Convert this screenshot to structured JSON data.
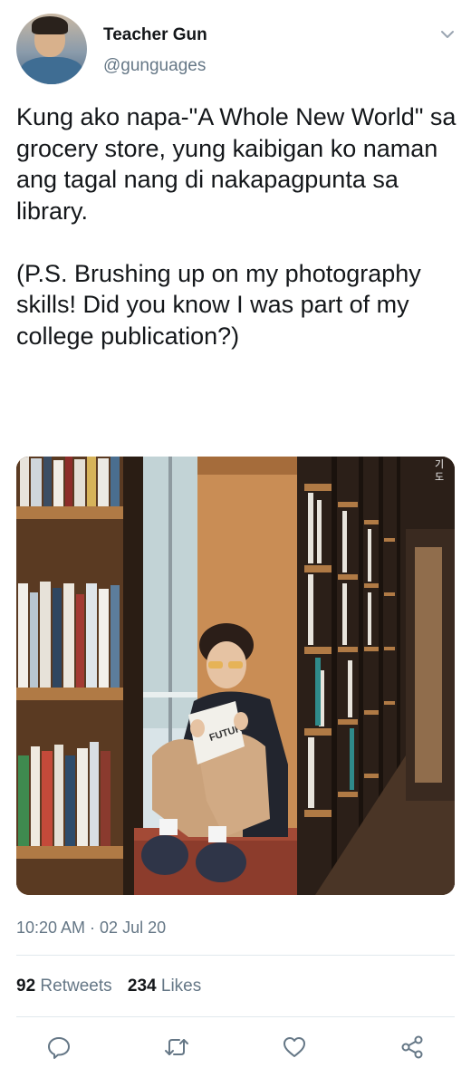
{
  "tweet": {
    "author": {
      "display_name": "Teacher Gun",
      "handle": "@gunguages",
      "avatar": "profile-photo"
    },
    "text": "Kung ako napa-\"A Whole New World\" sa grocery store, yung kaibigan ko naman ang tagal nang di nakapagpunta sa library.\n\n(P.S. Brushing up on my photography skills! Did you know I was part of my college publication?)",
    "photo": {
      "description_icon": "photo-library-person-reading",
      "sign_text": "기\n도",
      "book_cover_text": "FUTURE"
    },
    "timestamp": "10:20 AM · 02 Jul 20",
    "stats": {
      "retweets_count": "92",
      "retweets_label": "Retweets",
      "likes_count": "234",
      "likes_label": "Likes"
    }
  },
  "colors": {
    "text_primary": "#14171a",
    "text_secondary": "#657786",
    "divider": "#e1e8ed"
  },
  "icons": {
    "menu": "chevron-down-icon",
    "reply": "reply-icon",
    "retweet": "retweet-icon",
    "like": "heart-icon",
    "share": "share-icon"
  }
}
